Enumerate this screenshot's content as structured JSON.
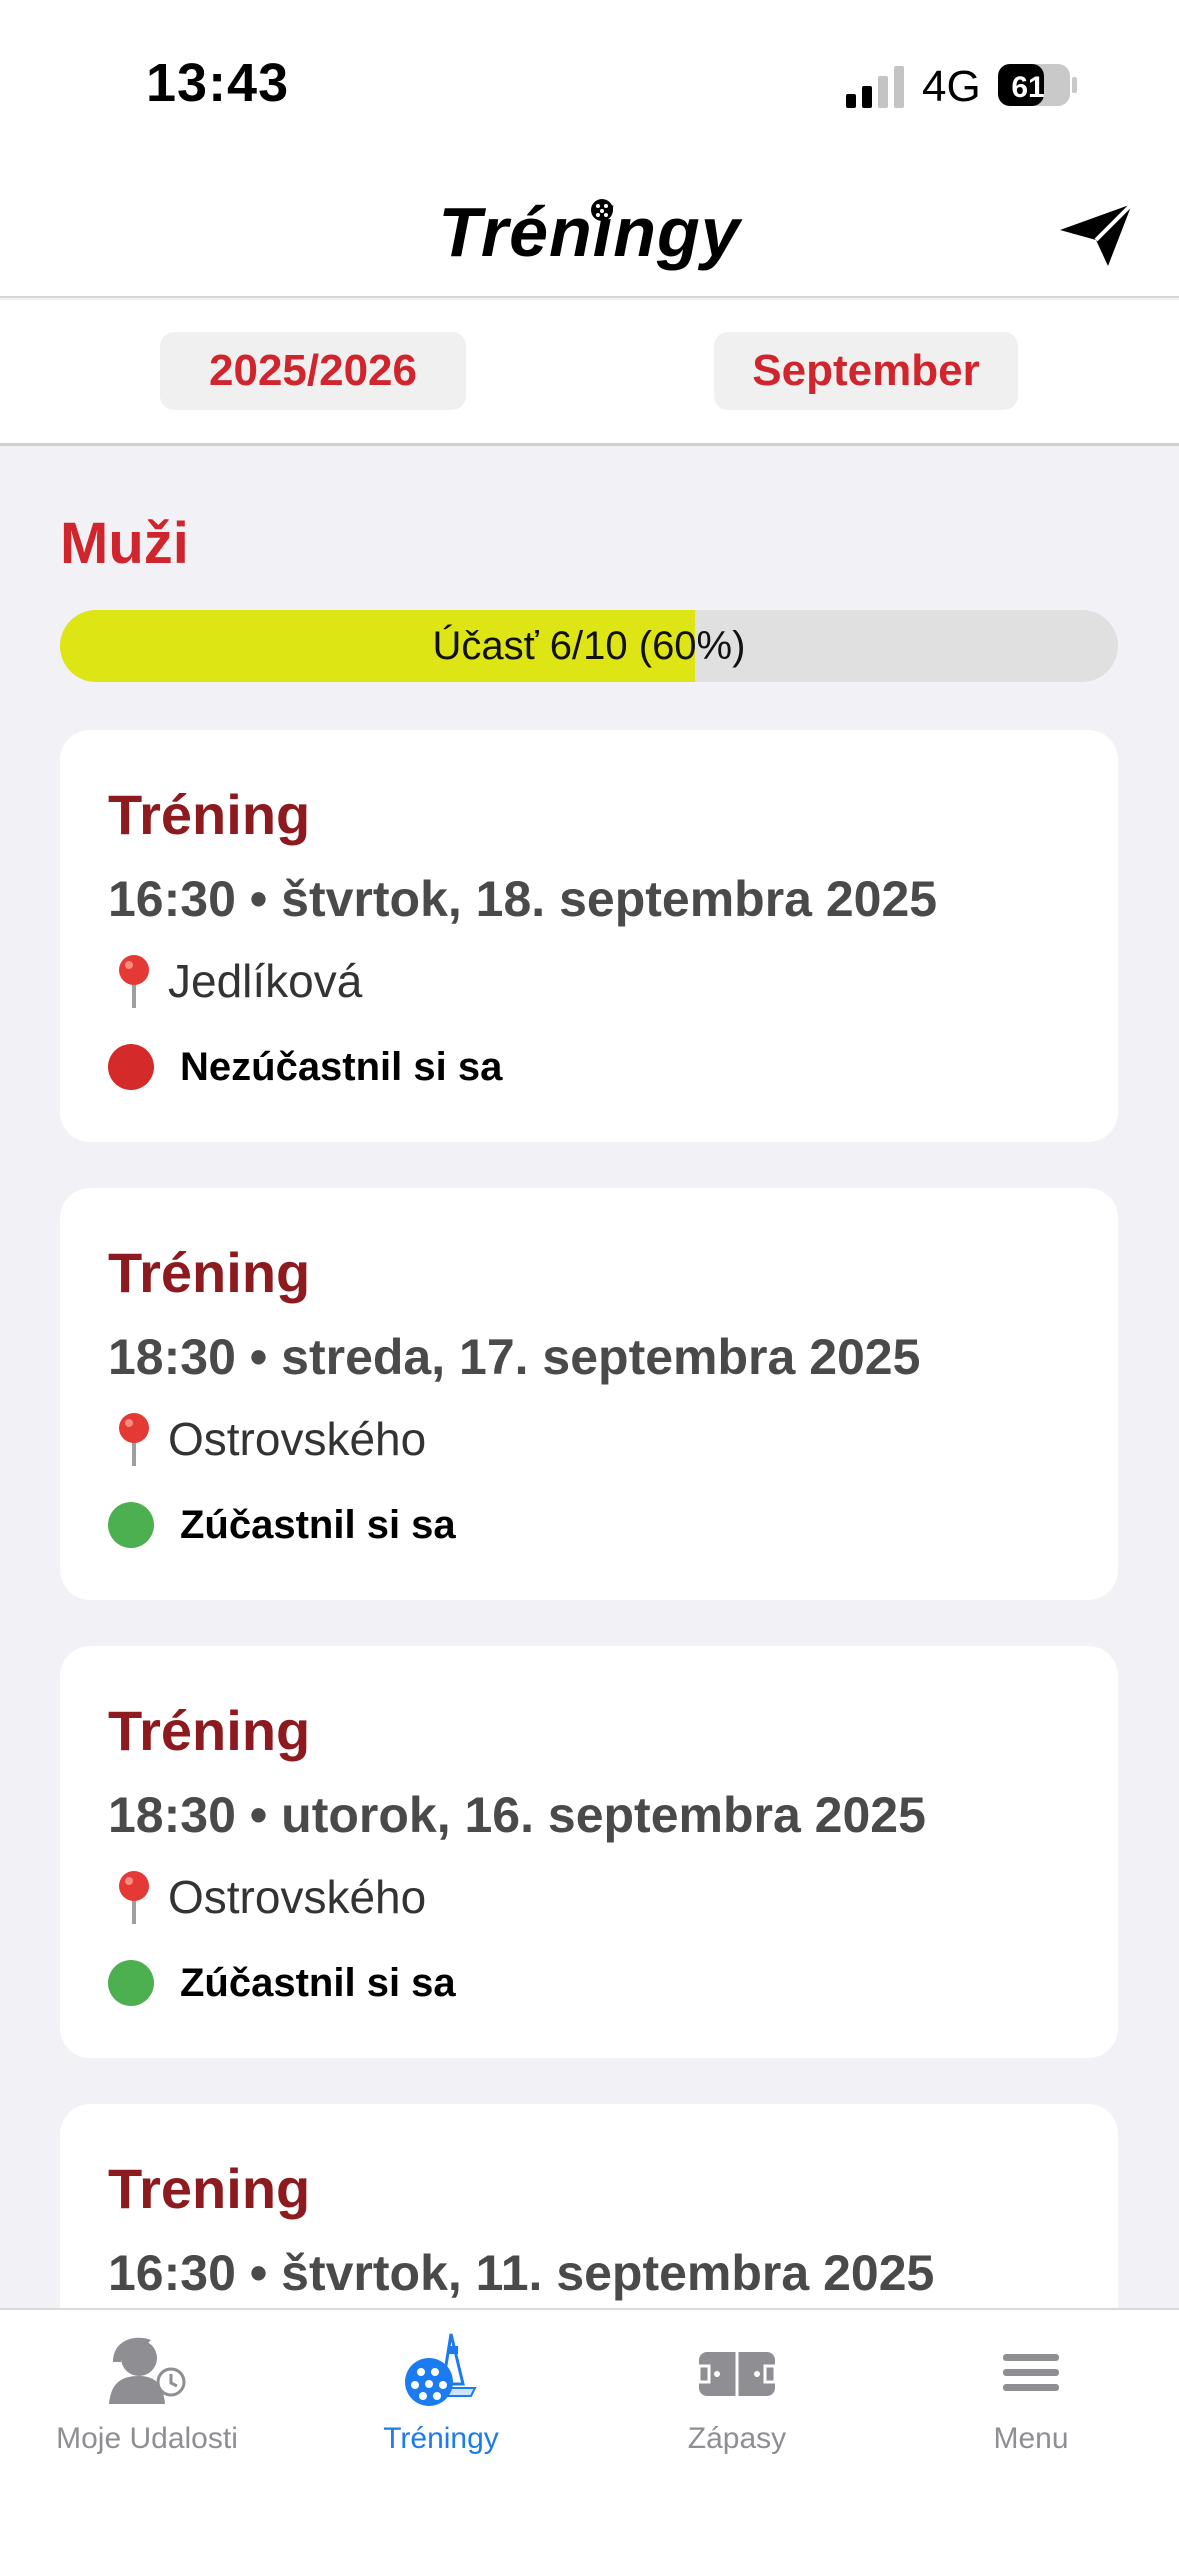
{
  "status_bar": {
    "time": "13:43",
    "network": "4G",
    "battery": "61"
  },
  "header": {
    "title": "Tréningy"
  },
  "filters": {
    "season": "2025/2026",
    "month": "September"
  },
  "section": {
    "title": "Muži",
    "attendance_label": "Účasť 6/10 (60%)",
    "attendance_fraction": 0.6
  },
  "events": [
    {
      "title": "Tréning",
      "datetime": "16:30 • štvrtok, 18. septembra 2025",
      "location": "Jedlíková",
      "status": "Nezúčastnil si sa",
      "status_color": "#d42a2a"
    },
    {
      "title": "Tréning",
      "datetime": "18:30 • streda, 17. septembra 2025",
      "location": "Ostrovského",
      "status": "Zúčastnil si sa",
      "status_color": "#4caf50"
    },
    {
      "title": "Tréning",
      "datetime": "18:30 • utorok, 16. septembra 2025",
      "location": "Ostrovského",
      "status": "Zúčastnil si sa",
      "status_color": "#4caf50"
    },
    {
      "title": "Trening",
      "datetime": "16:30 • štvrtok, 11. septembra 2025"
    }
  ],
  "tabbar": {
    "tabs": [
      {
        "label": "Moje Udalosti",
        "icon": "person-clock-icon",
        "active": false
      },
      {
        "label": "Tréningy",
        "icon": "floorball-icon",
        "active": true
      },
      {
        "label": "Zápasy",
        "icon": "rink-icon",
        "active": false
      },
      {
        "label": "Menu",
        "icon": "hamburger-icon",
        "active": false
      }
    ]
  },
  "colors": {
    "accent": "#d1252e",
    "card_title": "#8c1a1e",
    "progress_fill": "#dde515",
    "tab_active": "#1a7cf0"
  }
}
